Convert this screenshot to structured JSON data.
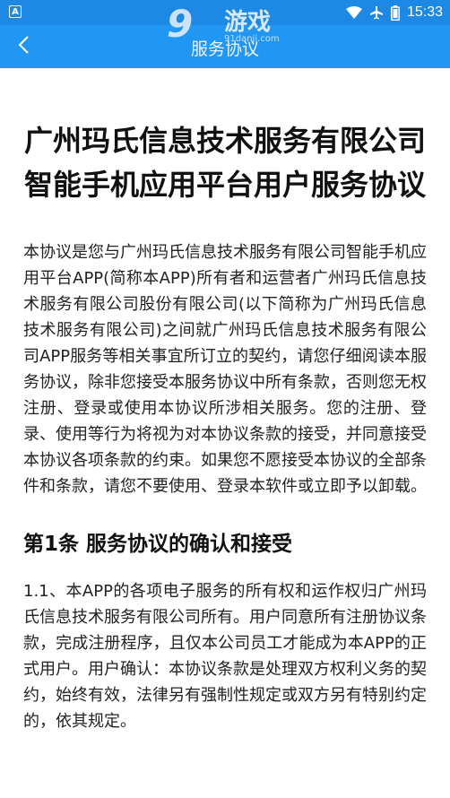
{
  "status_bar": {
    "left_icon": "A",
    "time": "15:33",
    "icons": [
      "wifi-icon",
      "airplane-icon",
      "battery-icon"
    ]
  },
  "app_bar": {
    "title": "服务协议",
    "back_icon": "chevron-left-icon"
  },
  "watermark": {
    "logo": "9",
    "text": "游戏",
    "sub": "91danji.com"
  },
  "document": {
    "title": "广州玛氏信息技术服务有限公司智能手机应用平台用户服务协议",
    "intro": "本协议是您与广州玛氏信息技术服务有限公司智能手机应用平台APP(简称本APP)所有者和运营者广州玛氏信息技术服务有限公司股份有限公司(以下简称为广州玛氏信息技术服务有限公司)之间就广州玛氏信息技术服务有限公司APP服务等相关事宜所订立的契约，请您仔细阅读本服务协议，除非您接受本服务协议中所有条款，否则您无权注册、登录或使用本协议所涉相关服务。您的注册、登录、使用等行为将视为对本协议条款的接受，并同意接受本协议各项条款的约束。如果您不愿接受本协议的全部条件和条款，请您不要使用、登录本软件或立即予以卸载。",
    "section1_heading": "第1条 服务协议的确认和接受",
    "section1_body": "1.1、本APP的各项电子服务的所有权和运作权归广州玛氏信息技术服务有限公司所有。用户同意所有注册协议条款，完成注册程序，且仅本公司员工才能成为本APP的正式用户。用户确认：本协议条款是处理双方权利义务的契约，始终有效，法律另有强制性规定或双方另有特别约定的，依其规定。"
  },
  "colors": {
    "status_bar": "#1e88e5",
    "app_bar": "#2196f3",
    "text": "#111111"
  }
}
